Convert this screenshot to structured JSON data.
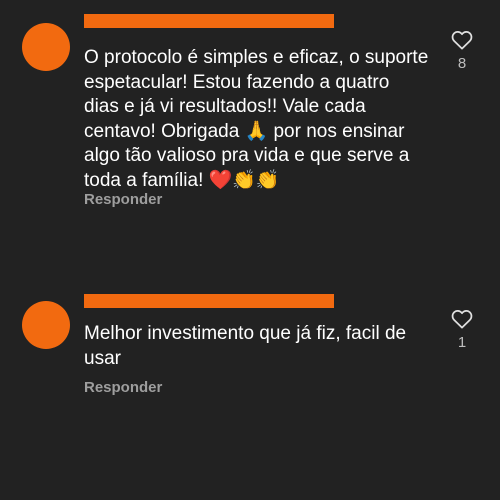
{
  "comments": [
    {
      "text": "O protocolo é simples e eficaz, o suporte\nespetacular! Estou fazendo a quatro\ndias e já vi resultados!! Vale cada\ncentavo! Obrigada 🙏 por nos ensinar\nalgo tão valioso pra vida e que serve a\ntoda a família! ❤️👏👏",
      "reply_label": "Responder",
      "like_count": "8",
      "like_icon": "heart-outline-icon"
    },
    {
      "text": "Melhor investimento que já fiz, facil de\nusar",
      "reply_label": "Responder",
      "like_count": "1",
      "like_icon": "heart-outline-icon"
    }
  ],
  "colors": {
    "background": "#222222",
    "avatar": "#f26a10",
    "redaction": "#f26a10",
    "reply": "#9e9e9e",
    "like_count": "#bdbdbd"
  }
}
